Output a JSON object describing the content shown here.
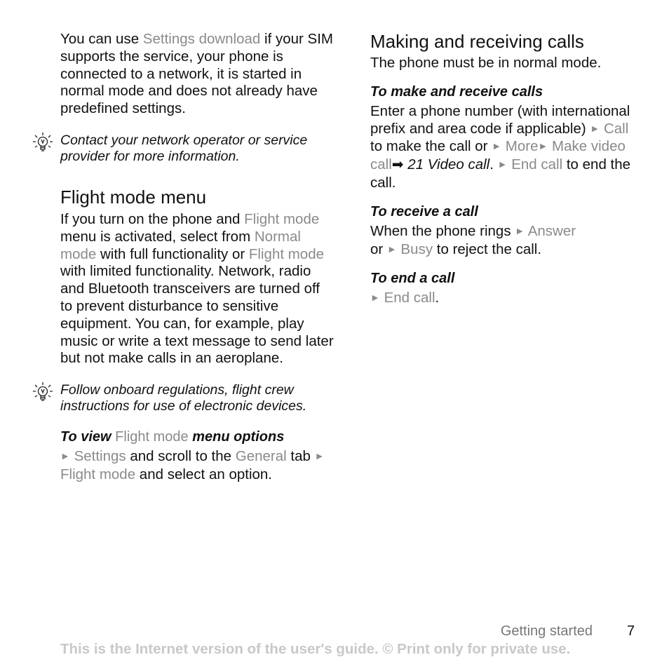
{
  "left": {
    "intro": {
      "t1": "You can use ",
      "link1": "Settings download",
      "t2": " if your SIM supports the service, your phone is connected to a network, it is started in normal mode and does not already have predefined settings."
    },
    "tip1": "Contact your network operator or service provider for more information.",
    "flight_heading": "Flight mode menu",
    "flight_body": {
      "t1": "If you turn on the phone and ",
      "link1": "Flight mode",
      "t2": " menu is activated, select from ",
      "link2": "Normal mode",
      "t3": " with full functionality or ",
      "link3": "Flight mode",
      "t4": " with limited functionality. Network, radio and Bluetooth transceivers are turned off to prevent disturbance to sensitive equipment. You can, for example, play music or write a text message to send later but not make calls in an aeroplane."
    },
    "tip2": "Follow onboard regulations, flight crew instructions for use of electronic devices.",
    "view_heading": {
      "t1": "To view ",
      "link1": "Flight mode",
      "t2": " menu options"
    },
    "view_body": {
      "link1": "Settings",
      "t1": " and scroll to the ",
      "link2": "General",
      "t2": " tab ",
      "link3": "Flight mode",
      "t3": " and select an option."
    }
  },
  "right": {
    "heading": "Making and receiving calls",
    "intro": "The phone must be in normal mode.",
    "make_heading": "To make and receive calls",
    "make_body": {
      "t1": "Enter a phone number (with international prefix and area code if applicable) ",
      "link1": "Call",
      "t2": " to make the call or ",
      "link2": "More",
      "link3": "Make video call",
      "xref": " 21 Video call",
      "t3": ". ",
      "link4": "End call",
      "t4": " to end the call."
    },
    "receive_heading": "To receive a call",
    "receive_body": {
      "t1": "When the phone rings ",
      "link1": "Answer",
      "t2": " or ",
      "link2": "Busy",
      "t3": " to reject the call."
    },
    "end_heading": "To end a call",
    "end_body": {
      "link1": "End call",
      "t1": "."
    }
  },
  "footer": {
    "section": "Getting started",
    "page_number": "7",
    "notice": "This is the Internet version of the user's guide. © Print only for private use."
  },
  "symbols": {
    "menu_arrow": "►",
    "xref_arrow": "➡"
  },
  "colors": {
    "text": "#111111",
    "menu_item": "#8a8a8a",
    "footer_notice": "#c8c8c8"
  }
}
